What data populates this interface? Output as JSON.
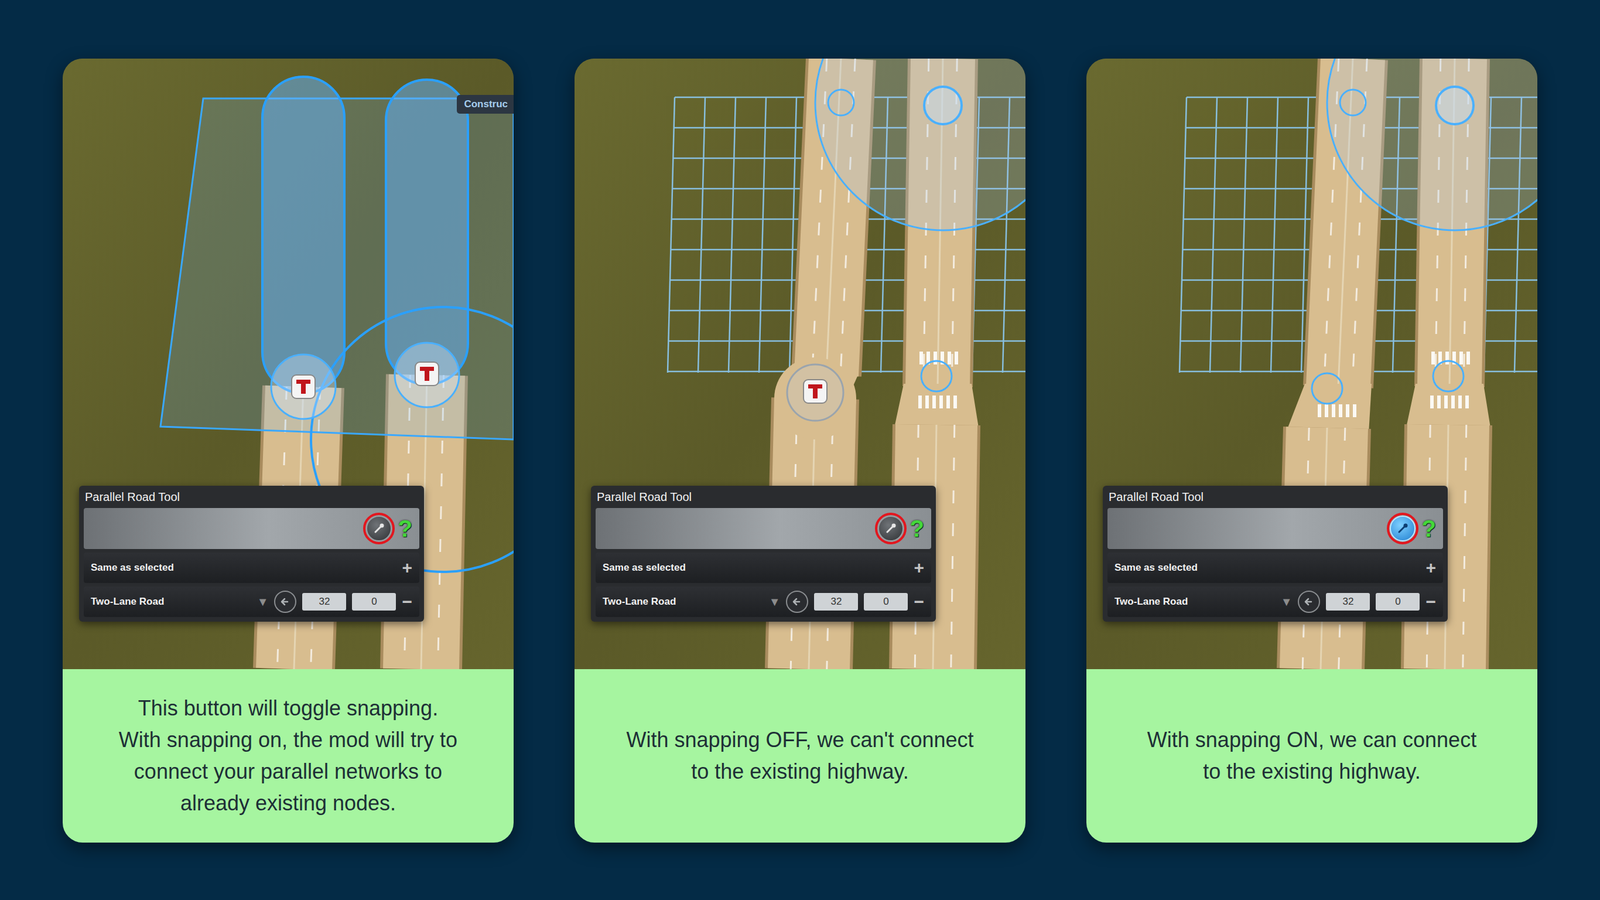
{
  "cards": [
    {
      "scene": "preview",
      "tag": "Construc",
      "panel": {
        "title": "Parallel Road Tool",
        "snapping": {
          "on": false,
          "annotated": true
        },
        "help": "?",
        "preset": "Same as selected",
        "add": "+",
        "network": "Two-Lane Road",
        "dropdown": "▼",
        "offset": "32",
        "elevation": "0",
        "remove": "−"
      },
      "caption": [
        "This button will toggle snapping.",
        "With snapping on, the mod will try to",
        "connect your parallel networks to",
        "already existing nodes."
      ]
    },
    {
      "scene": "snap-off",
      "tag": "",
      "panel": {
        "title": "Parallel Road Tool",
        "snapping": {
          "on": false,
          "annotated": true
        },
        "help": "?",
        "preset": "Same as selected",
        "add": "+",
        "network": "Two-Lane Road",
        "dropdown": "▼",
        "offset": "32",
        "elevation": "0",
        "remove": "−"
      },
      "caption": [
        "With snapping OFF, we can't connect",
        "to the existing highway."
      ]
    },
    {
      "scene": "snap-on",
      "tag": "",
      "panel": {
        "title": "Parallel Road Tool",
        "snapping": {
          "on": true,
          "annotated": true
        },
        "help": "?",
        "preset": "Same as selected",
        "add": "+",
        "network": "Two-Lane Road",
        "dropdown": "▼",
        "offset": "32",
        "elevation": "0",
        "remove": "−"
      },
      "caption": [
        "With snapping ON, we can connect",
        "to the existing highway."
      ]
    }
  ]
}
